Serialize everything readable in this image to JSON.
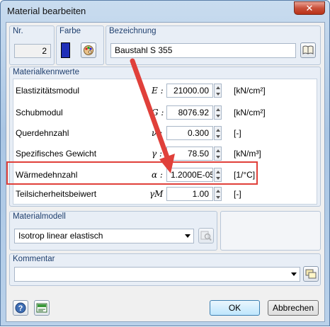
{
  "window": {
    "title": "Material bearbeiten",
    "close_symbol": "✕"
  },
  "header": {
    "nr_label": "Nr.",
    "nr_value": "2",
    "farbe_label": "Farbe",
    "color": "#1f2fb8",
    "bezeichnung_label": "Bezeichnung",
    "bezeichnung_value": "Baustahl S 355"
  },
  "materialkennwerte": {
    "group_label": "Materialkennwerte",
    "rows": [
      {
        "label": "Elastizitätsmodul",
        "symbol": "E :",
        "value": "21000.00",
        "unit": "[kN/cm²]"
      },
      {
        "label": "Schubmodul",
        "symbol": "G :",
        "value": "8076.92",
        "unit": "[kN/cm²]"
      },
      {
        "label": "Querdehnzahl",
        "symbol": "ν :",
        "value": "0.300",
        "unit": "[-]"
      },
      {
        "label": "Spezifisches Gewicht",
        "symbol": "γ :",
        "value": "78.50",
        "unit": "[kN/m³]"
      },
      {
        "label": "Wärmedehnzahl",
        "symbol": "α :",
        "value": "1.2000E-05",
        "unit": "[1/°C]"
      },
      {
        "label": "Teilsicherheitsbeiwert",
        "symbol": "γM :",
        "value": "1.00",
        "unit": "[-]"
      }
    ]
  },
  "materialmodell": {
    "group_label": "Materialmodell",
    "selected": "Isotrop linear elastisch"
  },
  "kommentar": {
    "group_label": "Kommentar",
    "value": ""
  },
  "buttons": {
    "ok": "OK",
    "cancel": "Abbrechen"
  },
  "colors": {
    "highlight": "#e0403a",
    "arrow": "#e0403a"
  }
}
